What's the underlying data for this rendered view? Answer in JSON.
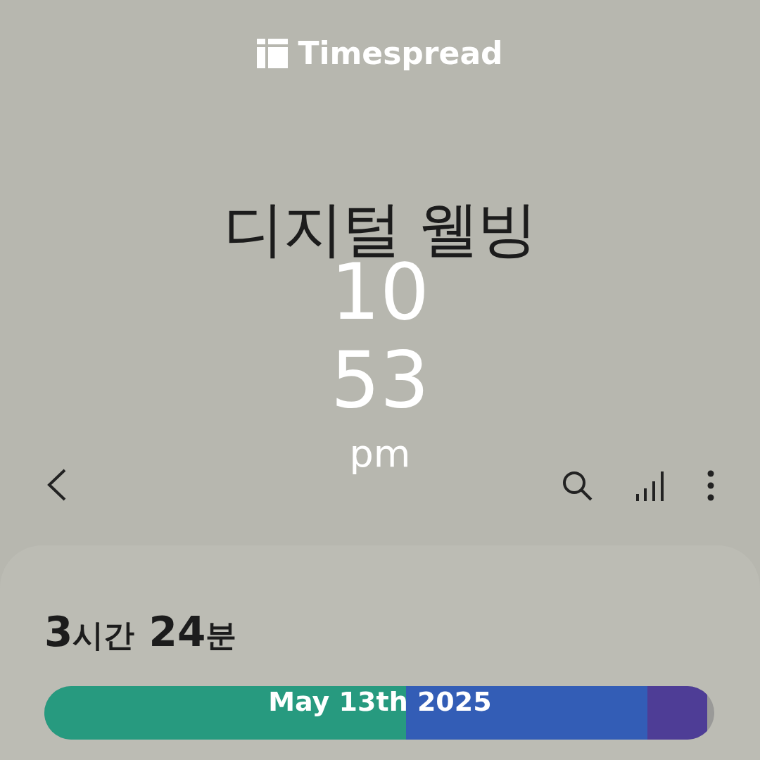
{
  "overlay": {
    "brand": "Timespread",
    "hour": "10",
    "minute": "53",
    "period": "pm",
    "date": "May 13th 2025"
  },
  "header": {
    "title": "디지털 웰빙"
  },
  "card": {
    "total": [
      {
        "kind": "number",
        "text": "3"
      },
      {
        "kind": "unit",
        "text": "시간"
      },
      {
        "kind": "number",
        "text": " 24"
      },
      {
        "kind": "unit",
        "text": "분"
      }
    ],
    "segments": [
      {
        "color": "#279a7f"
      },
      {
        "color": "#335db6"
      },
      {
        "color": "#4e3d96"
      }
    ]
  }
}
